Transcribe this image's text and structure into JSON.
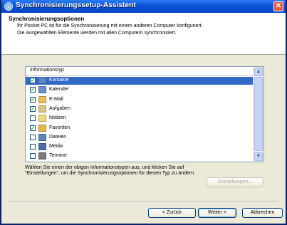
{
  "window": {
    "title": "Synchronisierungssetup-Assistent",
    "close_glyph": "✕"
  },
  "header": {
    "title": "Synchronisierungsoptionen",
    "line1": "Ihr Pocket PC ist für die Synchronisierung mit einem anderen Computer konfiguriert.",
    "line2": "Die ausgewählten Elemente werden mit allen Computern synchronisiert."
  },
  "list": {
    "column_header": "Informationstyp",
    "items": [
      {
        "label": "Kontakte",
        "checked": true,
        "selected": true,
        "icon": "contacts-icon",
        "color": "#5b86c9"
      },
      {
        "label": "Kalender",
        "checked": true,
        "selected": false,
        "icon": "calendar-icon",
        "color": "#6b8fcf"
      },
      {
        "label": "E-Mail",
        "checked": true,
        "selected": false,
        "icon": "email-icon",
        "color": "#e8c05a"
      },
      {
        "label": "Aufgaben",
        "checked": true,
        "selected": false,
        "icon": "tasks-icon",
        "color": "#d9c483"
      },
      {
        "label": "Notizen",
        "checked": false,
        "selected": false,
        "icon": "notes-icon",
        "color": "#f1d87a"
      },
      {
        "label": "Favoriten",
        "checked": true,
        "selected": false,
        "icon": "favorites-icon",
        "color": "#e8b64a"
      },
      {
        "label": "Dateien",
        "checked": false,
        "selected": false,
        "icon": "files-icon",
        "color": "#5e86b8"
      },
      {
        "label": "Media",
        "checked": false,
        "selected": false,
        "icon": "media-icon",
        "color": "#4b6fa6"
      },
      {
        "label": "Termine",
        "checked": false,
        "selected": false,
        "icon": "appointments-icon",
        "color": "#7a7a7a"
      }
    ]
  },
  "help_text": "Wählen Sie einen der obigen Informationstypen aus, und klicken Sie auf \"Einstellungen\", um die Synchronisierungsoptionen für diesen Typ zu ändern.",
  "buttons": {
    "settings": "Einstellungen...",
    "back": "< Zurück",
    "next": "Weiter >",
    "cancel": "Abbrechen"
  },
  "scroll": {
    "up": "▲",
    "down": "▼"
  }
}
